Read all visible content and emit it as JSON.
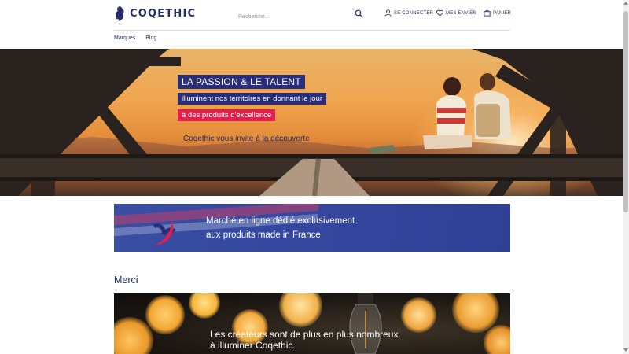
{
  "header": {
    "logo_text": "COQETHIC",
    "search": {
      "placeholder": "Recherche..."
    },
    "account": {
      "login": "Se connecter",
      "wishlist": "Mes envies",
      "cart": "Panier"
    },
    "nav": [
      "Marques",
      "Blog"
    ]
  },
  "hero": {
    "line1": "LA PASSION & LE TALENT",
    "line2": "illuminent nos territoires en donnant le jour",
    "line3": "à des produits d'excellence",
    "subtitle": "Coqethic vous invite à la découverte"
  },
  "banner": {
    "line1": "Marché en ligne dédié exclusivement",
    "line2": "aux produits made in France"
  },
  "section_title": "Merci",
  "lights": {
    "line1": "Les créateurs sont de plus en plus nombreux",
    "line2": "à illuminer Coqethic."
  },
  "colors": {
    "brand_blue": "#252f6b",
    "accent_red": "#e31e4a",
    "tag_blue": "#2a2d7a"
  },
  "icons": [
    "rooster-logo-icon",
    "search-icon",
    "user-icon",
    "heart-icon",
    "cart-icon"
  ]
}
